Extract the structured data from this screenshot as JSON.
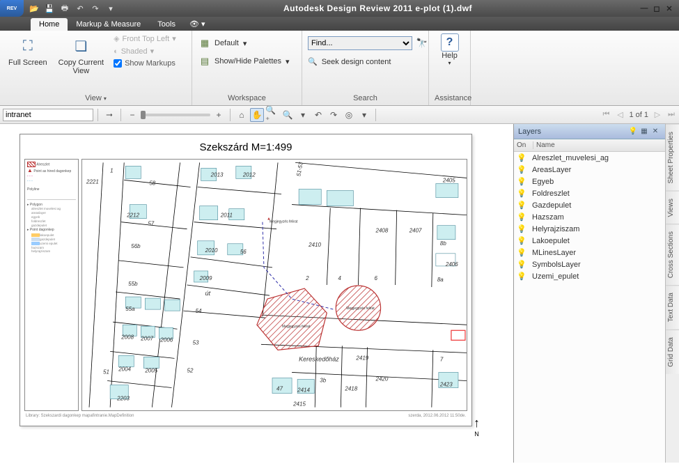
{
  "title": "Autodesk Design Review 2011    e-plot (1).dwf",
  "app_icon_label": "REV",
  "qat": {
    "open": "open",
    "save": "save",
    "print": "print",
    "undo": "undo",
    "redo": "redo"
  },
  "tabs": {
    "home": "Home",
    "markup": "Markup & Measure",
    "tools": "Tools"
  },
  "ribbon": {
    "view": {
      "full_screen": "Full Screen",
      "copy_view": "Copy Current\nView",
      "front_top_left": "Front Top Left",
      "shaded": "Shaded",
      "show_markups": "Show Markups",
      "group_title": "View"
    },
    "workspace": {
      "default": "Default",
      "show_hide": "Show/Hide Palettes",
      "group_title": "Workspace"
    },
    "search": {
      "find_placeholder": "Find...",
      "seek": "Seek design content",
      "group_title": "Search"
    },
    "assistance": {
      "help": "Help",
      "group_title": "Assistance"
    }
  },
  "strip": {
    "input_value": "intranet",
    "page_label": "1 of 1"
  },
  "sheet": {
    "title": "Szekszárd M=1:499",
    "footer_left": "Library: Szekszardi dagonkep mapafintranie.MapDefinition",
    "footer_right": "szerda, 2012.06.2012 11:50de.",
    "street_label_1": "út",
    "street_label_2": "Kereskedőház",
    "markup_label": "Megjegyzés felirat"
  },
  "parcels": [
    "2221",
    "58",
    "57",
    "2212",
    "2013",
    "2012",
    "51-53",
    "2405",
    "2011",
    "2408",
    "2407",
    "2410",
    "8b",
    "56b",
    "2010",
    "56",
    "2",
    "4",
    "6",
    "8a",
    "2406",
    "2009",
    "55b",
    "55a",
    "2008",
    "2007",
    "2006",
    "54",
    "53",
    "2004",
    "2005",
    "52",
    "2419",
    "47",
    "2414",
    "3b",
    "2418",
    "2420",
    "7",
    "2423",
    "51",
    "2203",
    "2415",
    "1"
  ],
  "legend": {
    "items": [
      "Alreszlet",
      "Point as hired dagonkep",
      "Polyline",
      "Polygon",
      "Point dagonkep"
    ]
  },
  "layers": {
    "title": "Layers",
    "col_on": "On",
    "col_name": "Name",
    "items": [
      "Alreszlet_muvelesi_ag",
      "AreasLayer",
      "Egyeb",
      "Foldreszlet",
      "Gazdepulet",
      "Hazszam",
      "Helyrajziszam",
      "Lakoepulet",
      "MLinesLayer",
      "SymbolsLayer",
      "Uzemi_epulet"
    ]
  },
  "side_tabs": [
    "Sheet Properties",
    "Views",
    "Cross Sections",
    "Text Data",
    "Grid Data"
  ]
}
